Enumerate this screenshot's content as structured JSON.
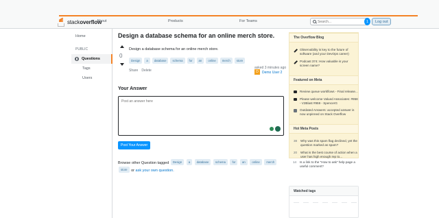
{
  "header": {
    "logo_stack": "stack",
    "logo_overflow": "overflow",
    "nav": [
      "About",
      "Products",
      "For Teams"
    ],
    "search_placeholder": "Search...",
    "search_badge": "1",
    "logout_label": "Log out"
  },
  "sidebar": {
    "home": "Home",
    "section": "PUBLIC",
    "questions": "Questions",
    "tags": "Tags",
    "users": "Users"
  },
  "question": {
    "title": "Design a database schema for an online merch store.",
    "votes": "0",
    "body": "Design a database schema for an online merch store.",
    "tags": [
      "Design",
      "a",
      "database",
      "schema",
      "for",
      "an",
      "online",
      "merch",
      "store"
    ],
    "share": "Share",
    "delete": "Delete",
    "asked": "asked 3 minutes ago",
    "avatar_letter": "D",
    "user": "Demo User 2"
  },
  "answer": {
    "heading": "Your Answer",
    "placeholder": "Post an answer here",
    "post_button": "Post Your Answer",
    "browse_prefix": "Browse other Question tagged",
    "browse_tags": [
      "Design",
      "a",
      "database",
      "schema",
      "for",
      "an",
      "online",
      "merch",
      "store"
    ],
    "browse_or": "or",
    "browse_link": "ask your own question."
  },
  "right": {
    "blog_title": "The Overflow Blog",
    "blog_items": [
      "Observability is key to the future of software (and your DevOps career)",
      "Podcast 374: How valuable is your screen name?"
    ],
    "meta_title": "Featured on Meta",
    "meta_items": [
      "Review queue workflows - Final release...",
      "Please welcome Valued Associates: #958 - V2Blast #959 - SpencerG",
      "Outdated Answers: accepted answer is now unpinned on Stack Overflow"
    ],
    "hot_title": "Hot Meta Posts",
    "hot_items": [
      {
        "num": "38",
        "text": "Why was this spam flag declined, yet the question marked as spam?"
      },
      {
        "num": "20",
        "text": "What is the best course of action when a user has high enough rep to..."
      },
      {
        "num": "14",
        "text": "Is a link to the \"How to ask\" help page a useful comment?"
      }
    ],
    "watched_title": "Watched tags"
  },
  "colors": {
    "accent": "#f48225",
    "link": "#0074cc",
    "button": "#0a95ff",
    "tag_bg": "#e1ecf4",
    "blog_bg": "#fbf3d5"
  }
}
